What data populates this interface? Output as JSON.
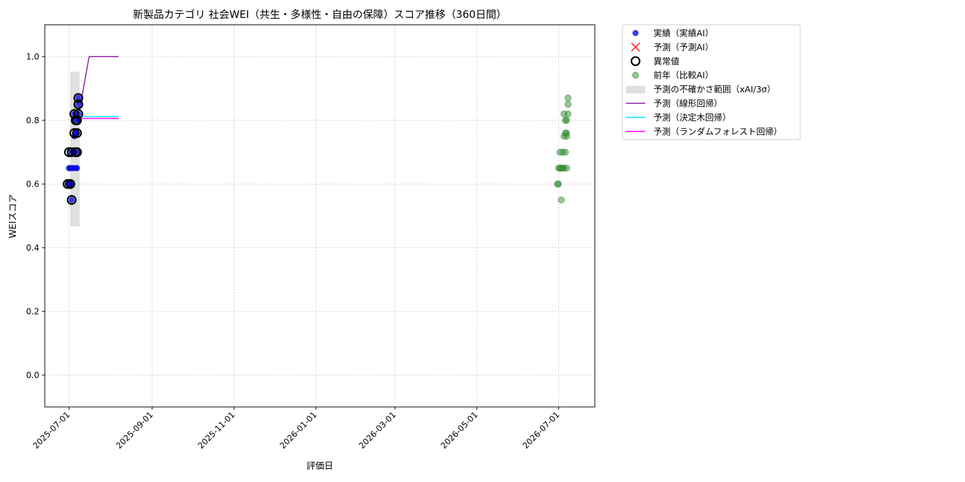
{
  "chart_data": {
    "type": "scatter",
    "title": "新製品カテゴリ 社会WEI（共生・多様性・自由の保障）スコア推移（360日間）",
    "xlabel": "評価日",
    "ylabel": "WEIスコア",
    "xlim": [
      "2025-06-13",
      "2026-07-28"
    ],
    "ylim": [
      -0.1,
      1.1
    ],
    "x_ticks": [
      "2025-07-01",
      "2025-09-01",
      "2025-11-01",
      "2026-01-01",
      "2026-03-01",
      "2026-05-01",
      "2026-07-01"
    ],
    "y_ticks": [
      "0.0",
      "0.2",
      "0.4",
      "0.6",
      "0.8",
      "1.0"
    ],
    "grid": true,
    "legend_position": "outside-right-top",
    "colors": {
      "actual": "#0000dd",
      "prediction_marker": "#ff3333",
      "anomaly": "#000000",
      "previous_year": "#2e8b2e",
      "uncertainty": "#cccccc",
      "linear": "#8b1fa0",
      "tree": "#00e5ff",
      "forest": "#ff00ff"
    },
    "legend": [
      {
        "key": "actual",
        "label": "実績（実績AI）",
        "kind": "dot"
      },
      {
        "key": "prediction",
        "label": "予測（予測AI）",
        "kind": "x"
      },
      {
        "key": "anomaly",
        "label": "異常値",
        "kind": "ring"
      },
      {
        "key": "previous_year",
        "label": "前年（比較AI）",
        "kind": "dot-green"
      },
      {
        "key": "uncertainty",
        "label": "予測の不確かさ範囲（xAI/3σ）",
        "kind": "band"
      },
      {
        "key": "linear",
        "label": "予測（線形回帰）",
        "kind": "line"
      },
      {
        "key": "tree",
        "label": "予測（決定木回帰）",
        "kind": "line"
      },
      {
        "key": "forest",
        "label": "予測（ランダムフォレスト回帰）",
        "kind": "line"
      }
    ],
    "uncertainty_band": {
      "x": [
        "2025-07-02",
        "2025-07-09"
      ],
      "y": [
        0.467,
        0.953
      ]
    },
    "actual": [
      {
        "x": "2025-06-30",
        "y": 0.6
      },
      {
        "x": "2025-07-01",
        "y": 0.6
      },
      {
        "x": "2025-07-01",
        "y": 0.65
      },
      {
        "x": "2025-07-02",
        "y": 0.6
      },
      {
        "x": "2025-07-02",
        "y": 0.7
      },
      {
        "x": "2025-07-02",
        "y": 0.65
      },
      {
        "x": "2025-07-03",
        "y": 0.65
      },
      {
        "x": "2025-07-03",
        "y": 0.6
      },
      {
        "x": "2025-07-03",
        "y": 0.55
      },
      {
        "x": "2025-07-04",
        "y": 0.7
      },
      {
        "x": "2025-07-04",
        "y": 0.65
      },
      {
        "x": "2025-07-05",
        "y": 0.7
      },
      {
        "x": "2025-07-05",
        "y": 0.75
      },
      {
        "x": "2025-07-05",
        "y": 0.82
      },
      {
        "x": "2025-07-06",
        "y": 0.76
      },
      {
        "x": "2025-07-06",
        "y": 0.65
      },
      {
        "x": "2025-07-06",
        "y": 0.8
      },
      {
        "x": "2025-07-07",
        "y": 0.7
      },
      {
        "x": "2025-07-07",
        "y": 0.76
      },
      {
        "x": "2025-07-07",
        "y": 0.65
      },
      {
        "x": "2025-07-08",
        "y": 0.8
      },
      {
        "x": "2025-07-08",
        "y": 0.82
      },
      {
        "x": "2025-07-08",
        "y": 0.85
      },
      {
        "x": "2025-07-08",
        "y": 0.87
      }
    ],
    "anomalies": [
      {
        "x": "2025-06-30",
        "y": 0.6
      },
      {
        "x": "2025-07-01",
        "y": 0.7
      },
      {
        "x": "2025-07-02",
        "y": 0.6
      },
      {
        "x": "2025-07-03",
        "y": 0.55
      },
      {
        "x": "2025-07-03",
        "y": 0.7
      },
      {
        "x": "2025-07-05",
        "y": 0.76
      },
      {
        "x": "2025-07-05",
        "y": 0.82
      },
      {
        "x": "2025-07-06",
        "y": 0.7
      },
      {
        "x": "2025-07-06",
        "y": 0.8
      },
      {
        "x": "2025-07-07",
        "y": 0.76
      },
      {
        "x": "2025-07-07",
        "y": 0.7
      },
      {
        "x": "2025-07-07",
        "y": 0.8
      },
      {
        "x": "2025-07-08",
        "y": 0.82
      },
      {
        "x": "2025-07-08",
        "y": 0.85
      },
      {
        "x": "2025-07-08",
        "y": 0.87
      }
    ],
    "previous_year": [
      {
        "x": "2026-06-30",
        "y": 0.6
      },
      {
        "x": "2026-07-01",
        "y": 0.6
      },
      {
        "x": "2026-07-01",
        "y": 0.65
      },
      {
        "x": "2026-07-02",
        "y": 0.7
      },
      {
        "x": "2026-07-02",
        "y": 0.65
      },
      {
        "x": "2026-07-03",
        "y": 0.65
      },
      {
        "x": "2026-07-03",
        "y": 0.55
      },
      {
        "x": "2026-07-04",
        "y": 0.7
      },
      {
        "x": "2026-07-04",
        "y": 0.65
      },
      {
        "x": "2026-07-05",
        "y": 0.75
      },
      {
        "x": "2026-07-05",
        "y": 0.82
      },
      {
        "x": "2026-07-05",
        "y": 0.65
      },
      {
        "x": "2026-07-06",
        "y": 0.76
      },
      {
        "x": "2026-07-06",
        "y": 0.8
      },
      {
        "x": "2026-07-06",
        "y": 0.7
      },
      {
        "x": "2026-07-07",
        "y": 0.75
      },
      {
        "x": "2026-07-07",
        "y": 0.8
      },
      {
        "x": "2026-07-07",
        "y": 0.65
      },
      {
        "x": "2026-07-08",
        "y": 0.82
      },
      {
        "x": "2026-07-08",
        "y": 0.85
      },
      {
        "x": "2026-07-08",
        "y": 0.87
      },
      {
        "x": "2026-07-07",
        "y": 0.76
      }
    ],
    "lines": [
      {
        "key": "linear",
        "points": [
          {
            "x": "2025-07-09",
            "y": 0.835
          },
          {
            "x": "2025-07-16",
            "y": 1.0
          },
          {
            "x": "2025-08-07",
            "y": 1.0
          }
        ]
      },
      {
        "key": "tree",
        "points": [
          {
            "x": "2025-07-09",
            "y": 0.812
          },
          {
            "x": "2025-08-07",
            "y": 0.812
          }
        ]
      },
      {
        "key": "forest",
        "points": [
          {
            "x": "2025-07-09",
            "y": 0.806
          },
          {
            "x": "2025-08-07",
            "y": 0.806
          }
        ]
      }
    ]
  }
}
